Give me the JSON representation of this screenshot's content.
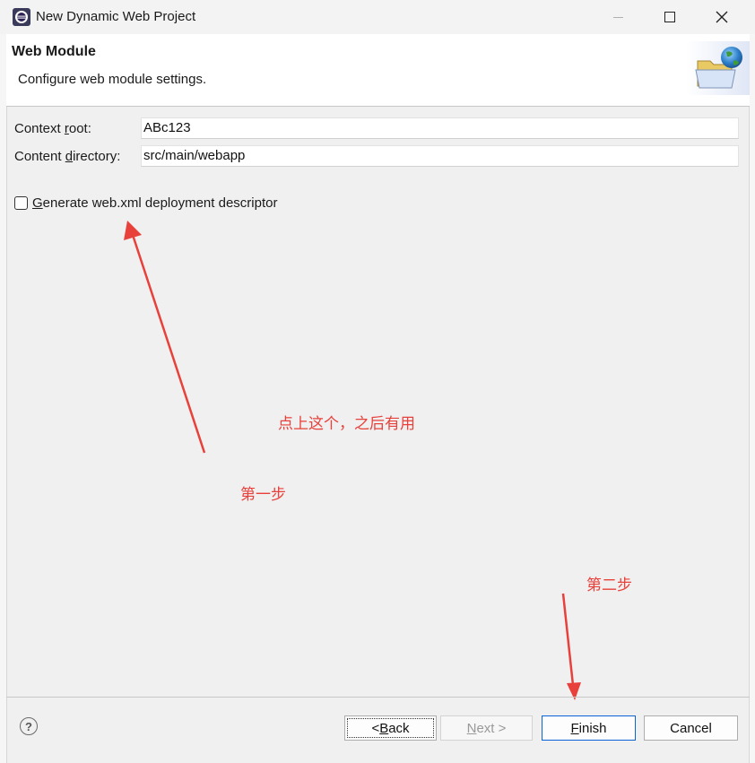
{
  "window": {
    "title": "New Dynamic Web Project"
  },
  "banner": {
    "title": "Web Module",
    "subtitle": "Configure web module settings."
  },
  "form": {
    "context_root": {
      "label_before": "Context ",
      "label_mnemonic": "r",
      "label_after": "oot:",
      "value": "ABc123"
    },
    "content_directory": {
      "label_before": "Content ",
      "label_mnemonic": "d",
      "label_after": "irectory:",
      "value": "src/main/webapp"
    },
    "generate_webxml": {
      "label_mnemonic": "G",
      "label_rest": "enerate web.xml deployment descriptor",
      "checked": false
    }
  },
  "annotations": {
    "note": "点上这个，之后有用",
    "step1": "第一步",
    "step2": "第二步"
  },
  "buttons": {
    "back": {
      "before": "< ",
      "mnemonic": "B",
      "after": "ack"
    },
    "next": {
      "mnemonic": "N",
      "after": "ext >"
    },
    "finish": {
      "mnemonic": "F",
      "after": "inish"
    },
    "cancel": "Cancel"
  },
  "colors": {
    "annotation": "#e8403a",
    "finish_border": "#0a64d8"
  },
  "icons": {
    "app": "eclipse-icon",
    "banner": "folder-globe-icon",
    "help": "help-icon"
  }
}
